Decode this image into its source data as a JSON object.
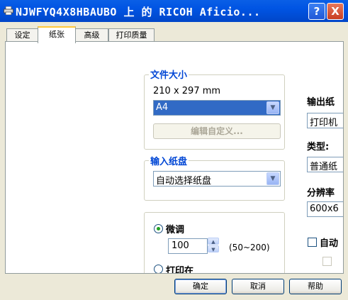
{
  "window": {
    "title": "NJWFYQ4X8HBAUBO 上 的 RICOH Aficio..."
  },
  "title_buttons": {
    "help": "?",
    "close": "X"
  },
  "tabs": [
    {
      "label": "设定"
    },
    {
      "label": "纸张"
    },
    {
      "label": "高级"
    },
    {
      "label": "打印质量"
    }
  ],
  "document_size": {
    "group_title": "文件大小",
    "dimensions": "210 x 297 mm",
    "selected": "A4",
    "edit_custom_label": "编辑自定义..."
  },
  "input_tray": {
    "group_title": "输入纸盘",
    "selected": "自动选择纸盘"
  },
  "scaling": {
    "fine_adjust_label": "微调",
    "value": "100",
    "range_hint": "(50~200)",
    "printer_label": "打印在"
  },
  "right_column": {
    "output_tray_label": "输出纸",
    "output_tray_value": "打印机",
    "type_label": "类型:",
    "type_value": "普通纸",
    "resolution_label": "分辨率",
    "resolution_value": "600x6",
    "auto_label": "自动"
  },
  "footer": {
    "ok": "确定",
    "cancel": "取消",
    "help": "帮助"
  },
  "colors": {
    "title_bar": "#0054E3",
    "group_title": "#0046D5",
    "selection": "#316AC5"
  }
}
